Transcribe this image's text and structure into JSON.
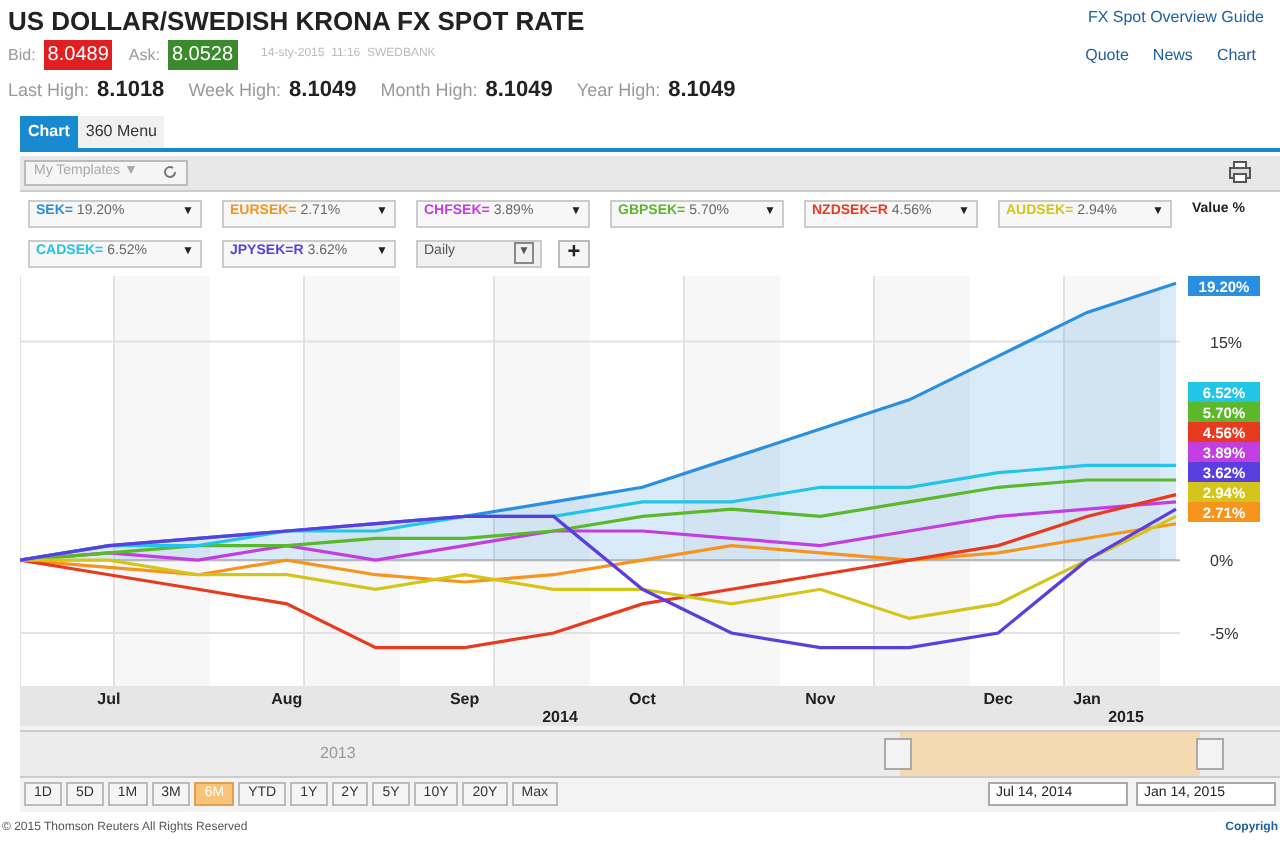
{
  "title": "US DOLLAR/SWEDISH KRONA FX SPOT RATE",
  "guide_link": "FX Spot Overview Guide",
  "links": [
    "Quote",
    "News",
    "Chart"
  ],
  "quote": {
    "bid_label": "Bid:",
    "bid": "8.0489",
    "ask_label": "Ask:",
    "ask": "8.0528",
    "timestamp": "14-sty-2015  11:16  SWEDBANK"
  },
  "highs": [
    {
      "label": "Last High:",
      "value": "8.1018"
    },
    {
      "label": "Week High:",
      "value": "8.1049"
    },
    {
      "label": "Month High:",
      "value": "8.1049"
    },
    {
      "label": "Year High:",
      "value": "8.1049"
    }
  ],
  "tabs": [
    {
      "label": "Chart",
      "selected": true
    },
    {
      "label": "360 Menu",
      "selected": false
    }
  ],
  "templates": "My Templates ▼",
  "legend": [
    {
      "value": "19.20%",
      "caret": "▼"
    },
    {
      "value": "2.71%",
      "caret": "▼"
    },
    {
      "value": "3.89%",
      "caret": "▼"
    },
    {
      "value": "5.70%",
      "caret": "▼"
    },
    {
      "value": "4.56%",
      "caret": "▼"
    },
    {
      "value": "2.94%",
      "caret": "▼"
    },
    {
      "value": "6.52%",
      "caret": "▼"
    },
    {
      "value": "3.62%",
      "caret": "▼"
    }
  ],
  "interval": {
    "label": "Daily",
    "caret": "▼"
  },
  "add": "+",
  "value_labels": [
    "19.20%",
    "6.52%",
    "5.70%",
    "4.56%",
    "3.89%",
    "3.62%",
    "2.94%",
    "2.71%"
  ],
  "year_labels": [
    "2014",
    "2015"
  ],
  "chart_data": {
    "type": "line",
    "ylabel": "Value %",
    "grid": true,
    "categories": [
      null,
      "Jul",
      null,
      "Aug",
      null,
      "Sep",
      null,
      "Oct",
      null,
      "Nov",
      null,
      "Dec",
      "Jan",
      null
    ],
    "yticks": [
      {
        "value": 15,
        "label": "15%"
      },
      {
        "value": 0,
        "label": "0%"
      },
      {
        "value": -5,
        "label": "-5%"
      }
    ],
    "ylim": [
      -8.5,
      19.5
    ],
    "series": [
      {
        "name": "SEK=",
        "color": "#2a8fe0",
        "values": [
          0,
          1,
          1.5,
          2,
          2.5,
          3,
          4,
          5,
          7,
          9,
          11,
          14,
          17,
          19
        ]
      },
      {
        "name": "EURSEK=",
        "color": "#f7941d",
        "values": [
          0,
          -0.5,
          -1,
          0,
          -1,
          -1.5,
          -1,
          0,
          1,
          0.5,
          0,
          0.5,
          1.5,
          2.5
        ]
      },
      {
        "name": "CHFSEK=",
        "color": "#c23ee0",
        "values": [
          0,
          0.5,
          0,
          1,
          0,
          1,
          2,
          2,
          1.5,
          1,
          2,
          3,
          3.5,
          4
        ]
      },
      {
        "name": "GBPSEK=",
        "color": "#5cb82b",
        "values": [
          0,
          0.5,
          1,
          1,
          1.5,
          1.5,
          2,
          3,
          3.5,
          3,
          4,
          5,
          5.5,
          5.5
        ]
      },
      {
        "name": "NZDSEK=R",
        "color": "#e83a1e",
        "values": [
          0,
          -1,
          -2,
          -3,
          -6,
          -6,
          -5,
          -3,
          -2,
          -1,
          0,
          1,
          3,
          4.5
        ]
      },
      {
        "name": "AUDSEK=",
        "color": "#d4c51a",
        "values": [
          0,
          0,
          -1,
          -1,
          -2,
          -1,
          -2,
          -2,
          -3,
          -2,
          -4,
          -3,
          0,
          3
        ]
      },
      {
        "name": "CADSEK=",
        "color": "#22c4e8",
        "values": [
          0,
          1,
          1,
          2,
          2,
          3,
          3,
          4,
          4,
          5,
          5,
          6,
          6.5,
          6.5
        ]
      },
      {
        "name": "JPYSEK=R",
        "color": "#5b3ee0",
        "values": [
          0,
          1,
          1.5,
          2,
          2.5,
          3,
          3,
          -2,
          -5,
          -6,
          -6,
          -5,
          0,
          3.5
        ]
      }
    ]
  },
  "navigator_year": "2013",
  "ranges": [
    {
      "label": "1D",
      "selected": false
    },
    {
      "label": "5D",
      "selected": false
    },
    {
      "label": "1M",
      "selected": false
    },
    {
      "label": "3M",
      "selected": false
    },
    {
      "label": "6M",
      "selected": true
    },
    {
      "label": "YTD",
      "selected": false
    },
    {
      "label": "1Y",
      "selected": false
    },
    {
      "label": "2Y",
      "selected": false
    },
    {
      "label": "5Y",
      "selected": false
    },
    {
      "label": "10Y",
      "selected": false
    },
    {
      "label": "20Y",
      "selected": false
    },
    {
      "label": "Max",
      "selected": false
    }
  ],
  "date_from": "Jul 14, 2014",
  "date_to": "Jan 14, 2015",
  "copyright": "© 2015 Thomson Reuters All Rights Reserved",
  "copyright_link": "Copyrigh"
}
